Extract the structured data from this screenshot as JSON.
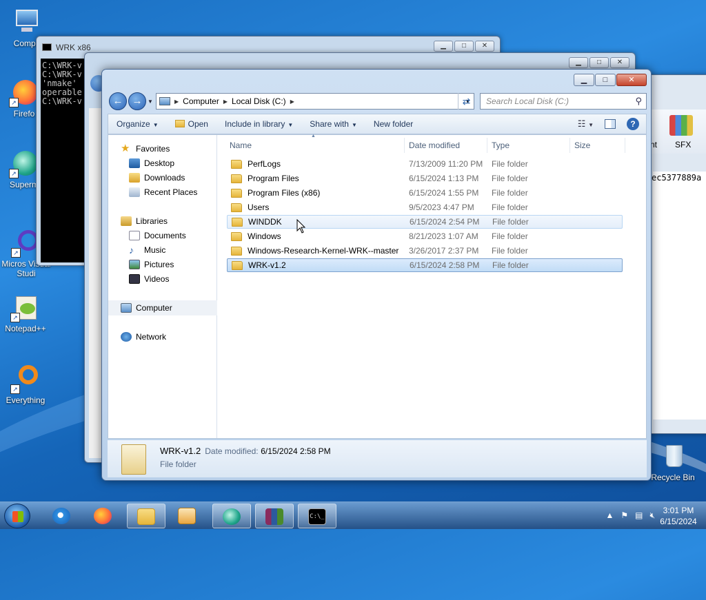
{
  "desktop": {
    "icons": [
      {
        "label": "Compu"
      },
      {
        "label": "Firefo"
      },
      {
        "label": "Superm"
      },
      {
        "label": "Micros Visual Studi"
      },
      {
        "label": "Notepad++"
      },
      {
        "label": "Everything"
      },
      {
        "label": "Recycle Bin"
      }
    ]
  },
  "bg_windows": {
    "cmd_title": "WRK x86",
    "cmd_lines": [
      "C:\\WRK-v",
      "C:\\WRK-v",
      "'nmake'",
      "operable",
      "C:\\WRK-v"
    ],
    "right_window_labels": [
      "nt",
      "SFX"
    ],
    "right_window_text": "ec5377889a"
  },
  "explorer": {
    "address": {
      "icon": "computer-icon",
      "segments": [
        "Computer",
        "Local Disk (C:)"
      ]
    },
    "search_placeholder": "Search Local Disk (C:)",
    "commands": {
      "organize": "Organize",
      "open": "Open",
      "include_in_library": "Include in library",
      "share_with": "Share with",
      "new_folder": "New folder"
    },
    "nav": {
      "favorites": "Favorites",
      "desktop": "Desktop",
      "downloads": "Downloads",
      "recent_places": "Recent Places",
      "libraries": "Libraries",
      "documents": "Documents",
      "music": "Music",
      "pictures": "Pictures",
      "videos": "Videos",
      "computer": "Computer",
      "network": "Network"
    },
    "columns": {
      "name": "Name",
      "date": "Date modified",
      "type": "Type",
      "size": "Size"
    },
    "files": [
      {
        "name": "PerfLogs",
        "date": "7/13/2009 11:20 PM",
        "type": "File folder"
      },
      {
        "name": "Program Files",
        "date": "6/15/2024 1:13 PM",
        "type": "File folder"
      },
      {
        "name": "Program Files (x86)",
        "date": "6/15/2024 1:55 PM",
        "type": "File folder"
      },
      {
        "name": "Users",
        "date": "9/5/2023 4:47 PM",
        "type": "File folder"
      },
      {
        "name": "WINDDK",
        "date": "6/15/2024 2:54 PM",
        "type": "File folder"
      },
      {
        "name": "Windows",
        "date": "8/21/2023 1:07 AM",
        "type": "File folder"
      },
      {
        "name": "Windows-Research-Kernel-WRK--master",
        "date": "3/26/2017 2:37 PM",
        "type": "File folder"
      },
      {
        "name": "WRK-v1.2",
        "date": "6/15/2024 2:58 PM",
        "type": "File folder"
      }
    ],
    "details": {
      "name": "WRK-v1.2",
      "date_label": "Date modified:",
      "date_value": "6/15/2024 2:58 PM",
      "type": "File folder"
    }
  },
  "taskbar": {
    "time": "3:01 PM",
    "date": "6/15/2024"
  }
}
